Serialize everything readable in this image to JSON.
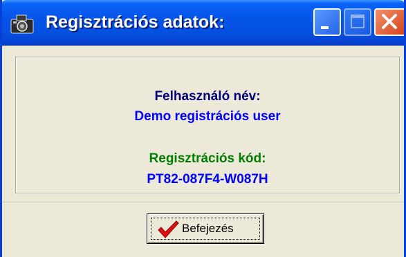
{
  "window": {
    "title": "Regisztrációs adatok:"
  },
  "info": {
    "username_label": "Felhasználó név:",
    "username_value": "Demo registrációs user",
    "code_label": "Regisztrációs kód:",
    "code_value": "PT82-087F4-W087H"
  },
  "actions": {
    "finish_label": "Befejezés"
  },
  "icons": {
    "app": "camera-icon",
    "finish": "checkmark-icon",
    "minimize": "minimize-icon",
    "maximize": "maximize-icon",
    "close": "close-icon"
  },
  "colors": {
    "titlebar": "#0555e8",
    "label_navy": "#00007f",
    "value_blue": "#0000ff",
    "label_green": "#007f00",
    "check_red": "#e01010",
    "close_button": "#d6401a"
  }
}
